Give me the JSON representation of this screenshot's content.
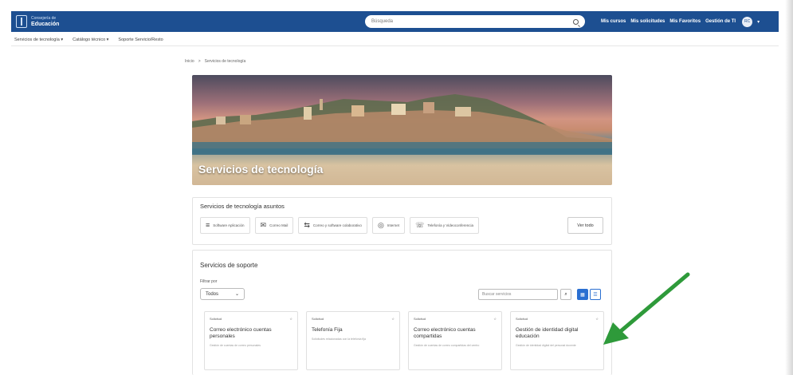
{
  "header": {
    "logo_line1": "Consejería de",
    "logo_line2": "Educación",
    "search_placeholder": "Búsqueda",
    "nav": [
      "Mis cursos",
      "Mis solicitudes",
      "Mis Favoritos",
      "Gestión de TI"
    ],
    "avatar_initials": "RC"
  },
  "subnav": [
    "Servicios de tecnología ▾",
    "Catálogo técnico ▾",
    "Soporte Servicio/Resto"
  ],
  "breadcrumb": [
    "Inicio",
    ">",
    "Servicios de tecnología"
  ],
  "hero": {
    "title": "Servicios de tecnología"
  },
  "featured": {
    "title": "Servicios de tecnología asuntos",
    "chips": [
      {
        "label": "Software Aplicación",
        "icon": "≡"
      },
      {
        "label": "Correo Mail",
        "icon": "✉"
      },
      {
        "label": "Correo y software colaborativo",
        "icon": "⇆"
      },
      {
        "label": "Internet",
        "icon": "◎"
      },
      {
        "label": "Telefonía y Videoconferencia",
        "icon": "☏"
      }
    ],
    "see_all": "Ver todo"
  },
  "support": {
    "title": "Servicios de soporte",
    "filter_label": "Filtrar por",
    "filter_value": "Todos",
    "search_placeholder": "Buscar servicios",
    "cards": [
      {
        "tag": "Solicitud",
        "title": "Correo electrónico cuentas personales",
        "desc": "Gestión de cuentas de correo personales"
      },
      {
        "tag": "Solicitud",
        "title": "Telefonía Fija",
        "desc": "Solicitudes relacionadas con la telefonía fija"
      },
      {
        "tag": "Solicitud",
        "title": "Correo electrónico cuentas compartidas",
        "desc": "Gestión de cuentas de correo compartidas del centro"
      },
      {
        "tag": "Solicitud",
        "title": "Gestión de identidad digital educación",
        "desc": "Gestión de identidad digital del personal docente"
      }
    ]
  },
  "colors": {
    "brand": "#1d4f91",
    "accent": "#2a6fd1",
    "arrow": "#2e9a3a"
  }
}
